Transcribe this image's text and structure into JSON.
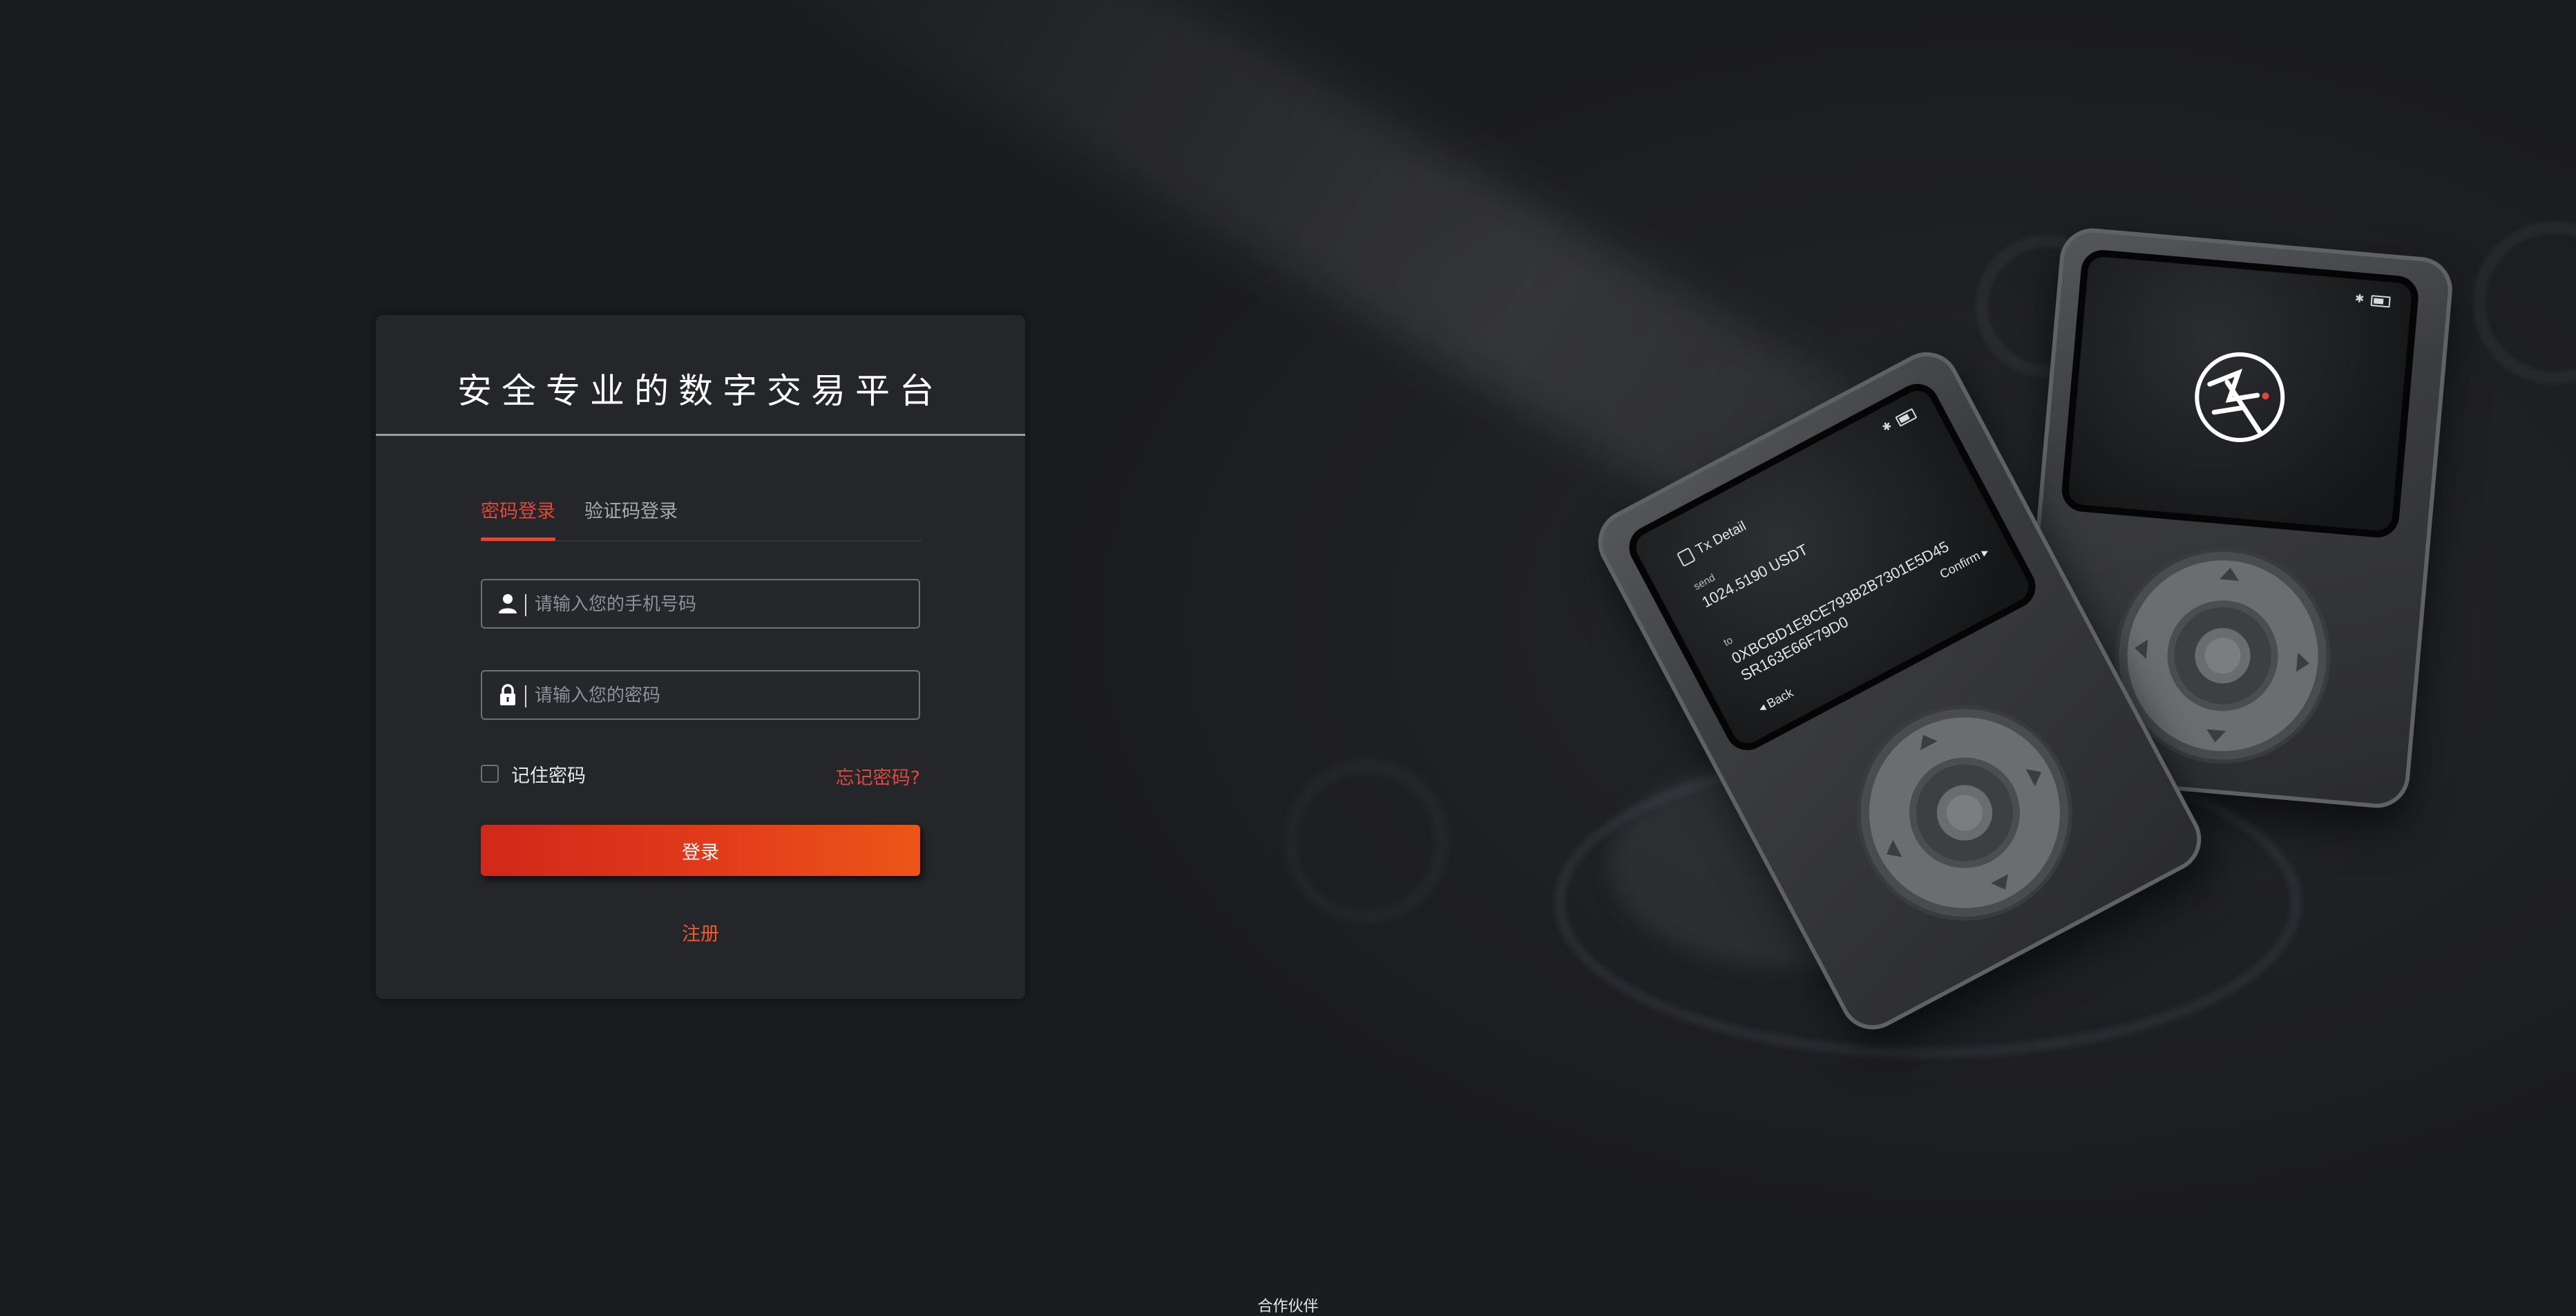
{
  "login": {
    "title": "安全专业的数字交易平台",
    "tabs": [
      {
        "label": "密码登录",
        "active": true
      },
      {
        "label": "验证码登录",
        "active": false
      }
    ],
    "phone_field": {
      "placeholder": "请输入您的手机号码",
      "value": "",
      "icon": "user-icon"
    },
    "password_field": {
      "placeholder": "请输入您的密码",
      "value": "",
      "icon": "lock-icon"
    },
    "remember_label": "记住密码",
    "remember_checked": false,
    "forgot_label": "忘记密码?",
    "login_button": "登录",
    "register_link": "注册"
  },
  "devices": {
    "tx_screen": {
      "title": "Tx Detail",
      "send_label": "send",
      "amount": "1024.5190 USDT",
      "to_label": "to",
      "address_line1": "0XBCBD1E8CE793B2B7301E5D45",
      "address_line2": "SR163E66F79D0",
      "confirm": "Confirm",
      "back": "Back"
    }
  },
  "footer": {
    "partners_label": "合作伙伴"
  },
  "colors": {
    "accent": "#e0473d",
    "button_start": "#d0281a",
    "button_end": "#ed5518",
    "card_bg": "#25262a",
    "page_bg": "#1c1d20"
  }
}
